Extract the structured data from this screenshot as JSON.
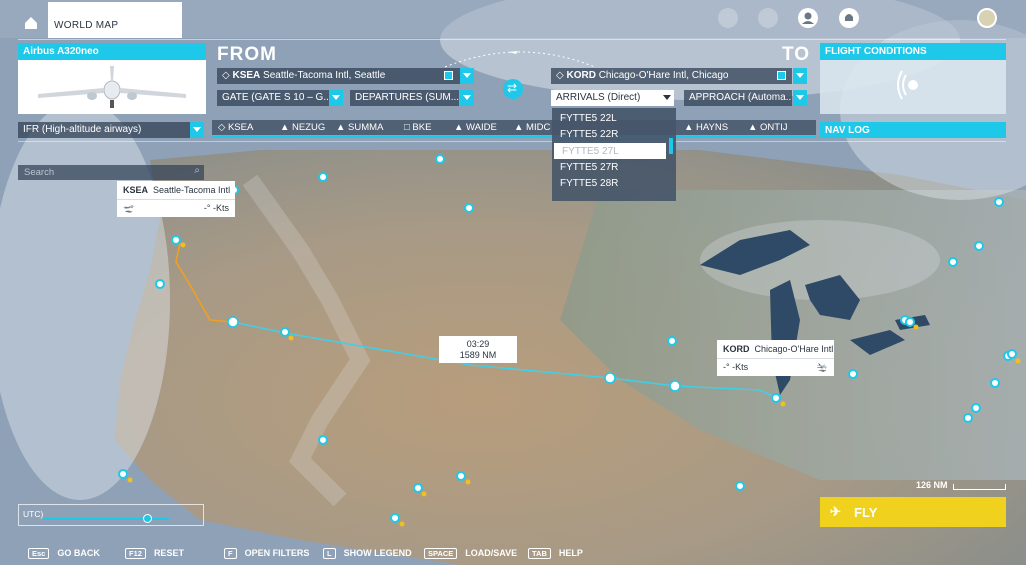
{
  "header": {
    "tab_label": "WORLD MAP",
    "icons": [
      "home-icon",
      "achievements-icon",
      "multiplayer-icon",
      "profile-icon",
      "notifications-icon",
      "pilot-avatar-icon"
    ]
  },
  "aircraft": {
    "title": "Airbus A320neo"
  },
  "from": {
    "label": "FROM",
    "airport_code": "KSEA",
    "airport_name": "Seattle-Tacoma Intl, Seattle",
    "gate": "GATE (GATE S 10 – G...",
    "departure": "DEPARTURES (SUM..."
  },
  "to": {
    "label": "TO",
    "airport_code": "KORD",
    "airport_name": "Chicago-O'Hare Intl, Chicago",
    "arrival": "ARRIVALS (Direct)",
    "approach": "APPROACH (Automa..."
  },
  "arrival_options": [
    "FYTTE5 22L",
    "FYTTE5 22R",
    "FYTTE5 27L",
    "FYTTE5 27R",
    "FYTTE5 28R"
  ],
  "arrival_highlighted": "FYTTE5 27L",
  "conditions": {
    "title": "FLIGHT CONDITIONS"
  },
  "route": {
    "type": "IFR (High-altitude airways)",
    "waypoints": [
      "KSEA",
      "NEZUG",
      "SUMMA",
      "BKE",
      "WAIDE",
      "MIDC",
      "HAYNS",
      "ONTIJ"
    ]
  },
  "navlog": {
    "title": "NAV LOG"
  },
  "search": {
    "placeholder": "Search"
  },
  "origin_callout": {
    "code": "KSEA",
    "name": "Seattle-Tacoma Intl",
    "wind": "-° -Kts"
  },
  "dest_callout": {
    "code": "KORD",
    "name": "Chicago-O'Hare Intl",
    "wind": "-° -Kts"
  },
  "flight_summary": {
    "time": "03:29",
    "distance": "1589 NM"
  },
  "scale": {
    "label": "126 NM"
  },
  "utc": {
    "label": "UTC)"
  },
  "fly_button": {
    "label": "FLY"
  },
  "footer": [
    {
      "key": "Esc",
      "label": "GO BACK"
    },
    {
      "key": "F12",
      "label": "RESET"
    },
    {
      "key": "F",
      "label": "OPEN FILTERS"
    },
    {
      "key": "L",
      "label": "SHOW LEGEND"
    },
    {
      "key": "SPACE",
      "label": "LOAD/SAVE"
    },
    {
      "key": "TAB",
      "label": "HELP"
    }
  ],
  "colors": {
    "accent": "#1ec8e8",
    "fly": "#f0d21e",
    "route_departure": "#f0a020"
  }
}
